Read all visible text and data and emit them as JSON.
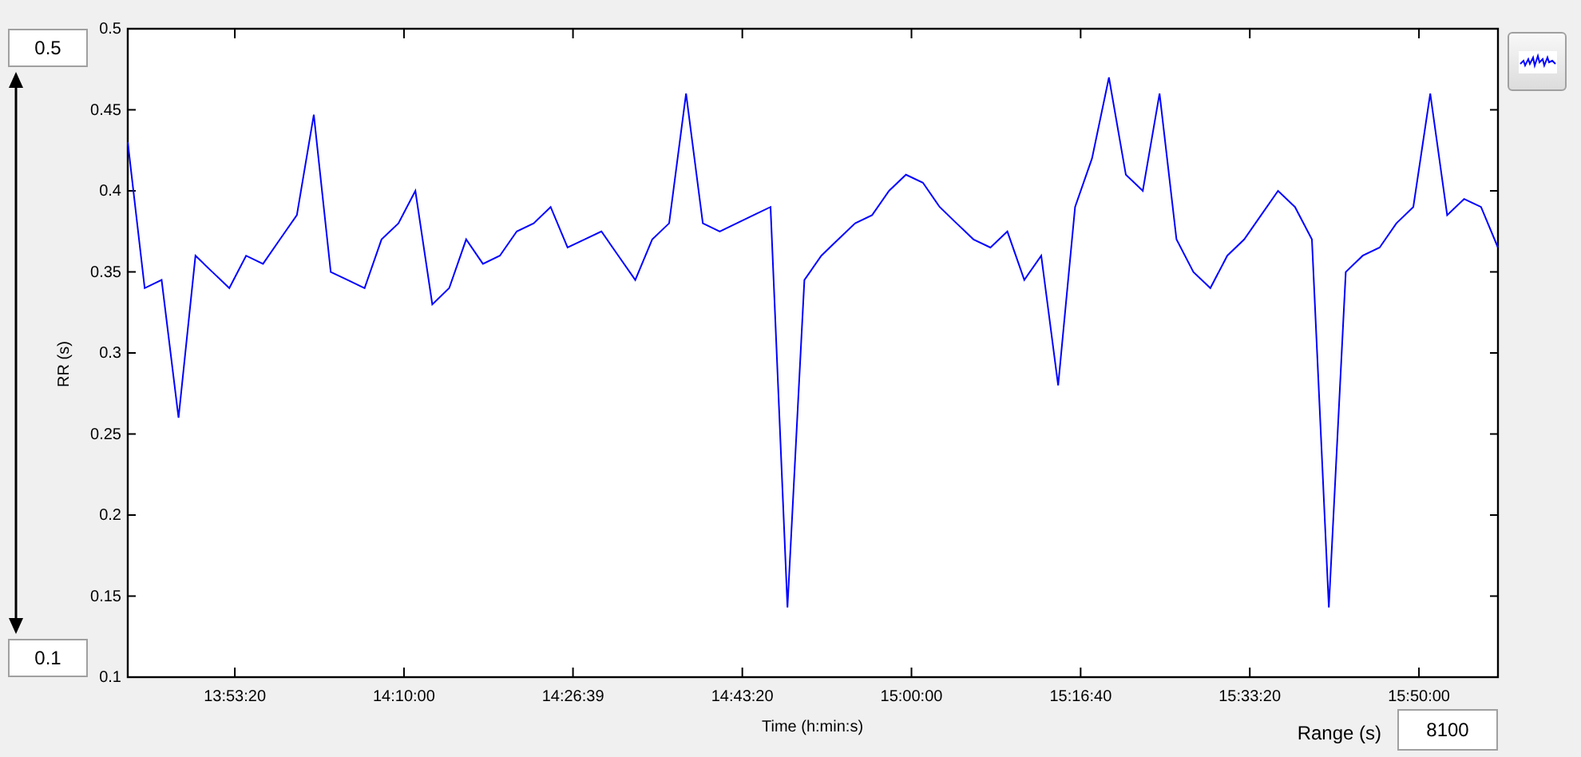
{
  "limits": {
    "max_field": "0.5",
    "min_field": "0.1"
  },
  "plot": {
    "chart_data": {
      "type": "line",
      "xlabel": "Time (h:min:s)",
      "ylabel": "RR (s)",
      "x": [
        49367,
        49467,
        49567,
        49667,
        49767,
        49867,
        49967,
        50067,
        50167,
        50267,
        50367,
        50467,
        50567,
        50667,
        50767,
        50867,
        50967,
        51067,
        51167,
        51267,
        51367,
        51467,
        51567,
        51667,
        51767,
        51867,
        51967,
        52067,
        52167,
        52267,
        52367,
        52467,
        52567,
        52667,
        52767,
        52867,
        52967,
        53067,
        53167,
        53267,
        53367,
        53467,
        53567,
        53667,
        53767,
        53867,
        53967,
        54067,
        54167,
        54267,
        54367,
        54467,
        54567,
        54667,
        54767,
        54867,
        54967,
        55067,
        55167,
        55267,
        55367,
        55467,
        55567,
        55667,
        55767,
        55867,
        55967,
        56067,
        56167,
        56267,
        56367,
        56467,
        56567,
        56667,
        56767,
        56867,
        56967,
        57067,
        57167,
        57267,
        57367,
        57467
      ],
      "series": [
        {
          "color": "#0000ff",
          "values": [
            0.43,
            0.34,
            0.345,
            0.26,
            0.36,
            0.35,
            0.34,
            0.36,
            0.355,
            0.37,
            0.385,
            0.447,
            0.35,
            0.345,
            0.34,
            0.37,
            0.38,
            0.4,
            0.33,
            0.34,
            0.37,
            0.355,
            0.36,
            0.375,
            0.38,
            0.39,
            0.365,
            0.37,
            0.375,
            0.36,
            0.345,
            0.37,
            0.38,
            0.46,
            0.38,
            0.375,
            0.38,
            0.385,
            0.39,
            0.143,
            0.345,
            0.36,
            0.37,
            0.38,
            0.385,
            0.4,
            0.41,
            0.405,
            0.39,
            0.38,
            0.37,
            0.365,
            0.375,
            0.345,
            0.36,
            0.28,
            0.39,
            0.42,
            0.47,
            0.41,
            0.4,
            0.46,
            0.37,
            0.35,
            0.34,
            0.36,
            0.37,
            0.385,
            0.4,
            0.39,
            0.37,
            0.143,
            0.35,
            0.36,
            0.365,
            0.38,
            0.39,
            0.46,
            0.385,
            0.395,
            0.39,
            0.365
          ]
        }
      ],
      "xlim": [
        49367,
        57467
      ],
      "ylim": [
        0.1,
        0.5
      ],
      "xticks": [
        {
          "value": 50000,
          "label": "13:53:20"
        },
        {
          "value": 51000,
          "label": "14:10:00"
        },
        {
          "value": 51999,
          "label": "14:26:39"
        },
        {
          "value": 53000,
          "label": "14:43:20"
        },
        {
          "value": 54000,
          "label": "15:00:00"
        },
        {
          "value": 55000,
          "label": "15:16:40"
        },
        {
          "value": 56000,
          "label": "15:33:20"
        },
        {
          "value": 57000,
          "label": "15:50:00"
        }
      ],
      "yticks": [
        0.1,
        0.15,
        0.2,
        0.25,
        0.3,
        0.35,
        0.4,
        0.45,
        0.5
      ]
    }
  },
  "range": {
    "label": "Range (s)",
    "value": "8100"
  }
}
